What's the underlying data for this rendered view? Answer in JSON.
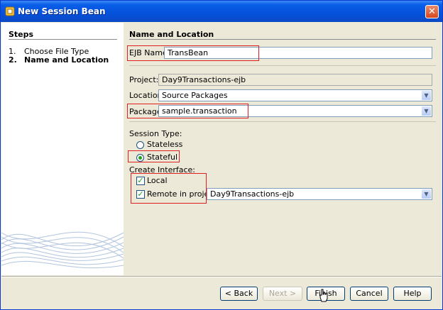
{
  "window": {
    "title": "New Session Bean",
    "close_glyph": "✕"
  },
  "steps": {
    "title": "Steps",
    "items": [
      {
        "num": "1.",
        "label": "Choose File Type",
        "active": false
      },
      {
        "num": "2.",
        "label": "Name and Location",
        "active": true
      }
    ]
  },
  "form": {
    "section_title": "Name and Location",
    "ejb_name_label": "EJB Name:",
    "ejb_name_value": "TransBean",
    "project_label": "Project:",
    "project_value": "Day9Transactions-ejb",
    "location_label": "Location:",
    "location_value": "Source Packages",
    "package_label": "Package:",
    "package_value": "sample.transaction",
    "session_type_label": "Session Type:",
    "stateless_label": "Stateless",
    "stateful_label": "Stateful",
    "selected_session_type": "Stateful",
    "create_interface_label": "Create Interface:",
    "local_label": "Local",
    "local_checked": true,
    "remote_label": "Remote in project:",
    "remote_checked": true,
    "remote_project_value": "Day9Transactions-ejb"
  },
  "buttons": {
    "back": "< Back",
    "next": "Next >",
    "finish": "Finish",
    "cancel": "Cancel",
    "help": "Help"
  },
  "colors": {
    "title_bar": "#0552dc",
    "highlight": "#e02020",
    "check": "#21a121"
  }
}
